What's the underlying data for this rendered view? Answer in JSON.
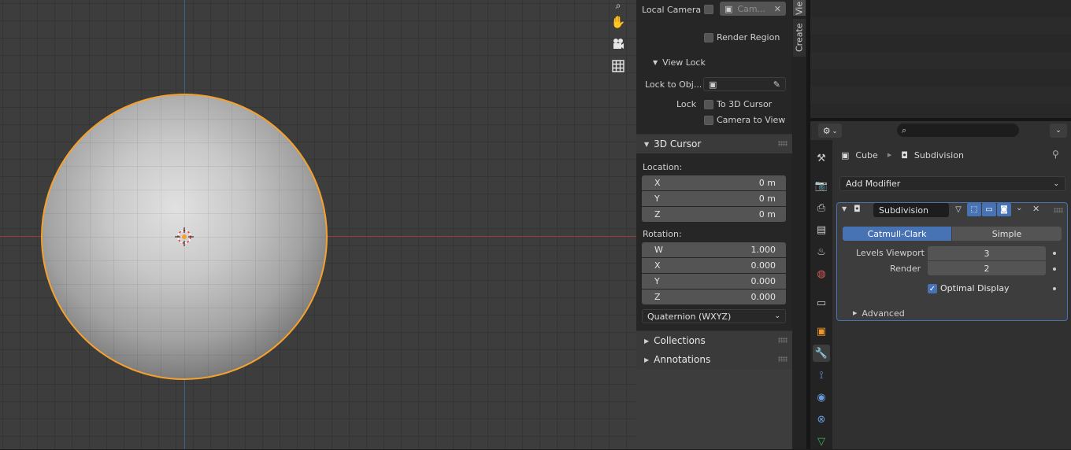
{
  "viewport": {
    "tools": [
      "zoom-icon",
      "hand-icon",
      "camera-icon",
      "grid-icon"
    ]
  },
  "npanel": {
    "local_camera_label": "Local Camera",
    "local_camera_value": "Cam...",
    "render_region_label": "Render Region",
    "view_lock_title": "View Lock",
    "lock_to_object_label": "Lock to Obj...",
    "lock_label": "Lock",
    "to_3d_cursor_label": "To 3D Cursor",
    "camera_to_view_label": "Camera to View",
    "cursor_title": "3D Cursor",
    "location_label": "Location:",
    "location": [
      {
        "axis": "X",
        "value": "0 m"
      },
      {
        "axis": "Y",
        "value": "0 m"
      },
      {
        "axis": "Z",
        "value": "0 m"
      }
    ],
    "rotation_label": "Rotation:",
    "rotation": [
      {
        "axis": "W",
        "value": "1.000"
      },
      {
        "axis": "X",
        "value": "0.000"
      },
      {
        "axis": "Y",
        "value": "0.000"
      },
      {
        "axis": "Z",
        "value": "0.000"
      }
    ],
    "rotation_mode": "Quaternion (WXYZ)",
    "collections_title": "Collections",
    "annotations_title": "Annotations"
  },
  "tabs": {
    "view": "Vie",
    "create": "Create"
  },
  "properties": {
    "breadcrumb_object": "Cube",
    "breadcrumb_modifier": "Subdivision",
    "add_modifier_label": "Add Modifier",
    "modifier_name": "Subdivision",
    "catmull_label": "Catmull-Clark",
    "simple_label": "Simple",
    "levels_viewport_label": "Levels Viewport",
    "levels_viewport_value": "3",
    "render_label": "Render",
    "render_value": "2",
    "optimal_display_label": "Optimal Display",
    "optimal_display_checked": true,
    "advanced_label": "Advanced"
  },
  "colors": {
    "accent": "#4772b3",
    "selection_outline": "#f5a12d",
    "x_axis": "#9a3a3f",
    "y_axis": "#3b5f8f"
  }
}
